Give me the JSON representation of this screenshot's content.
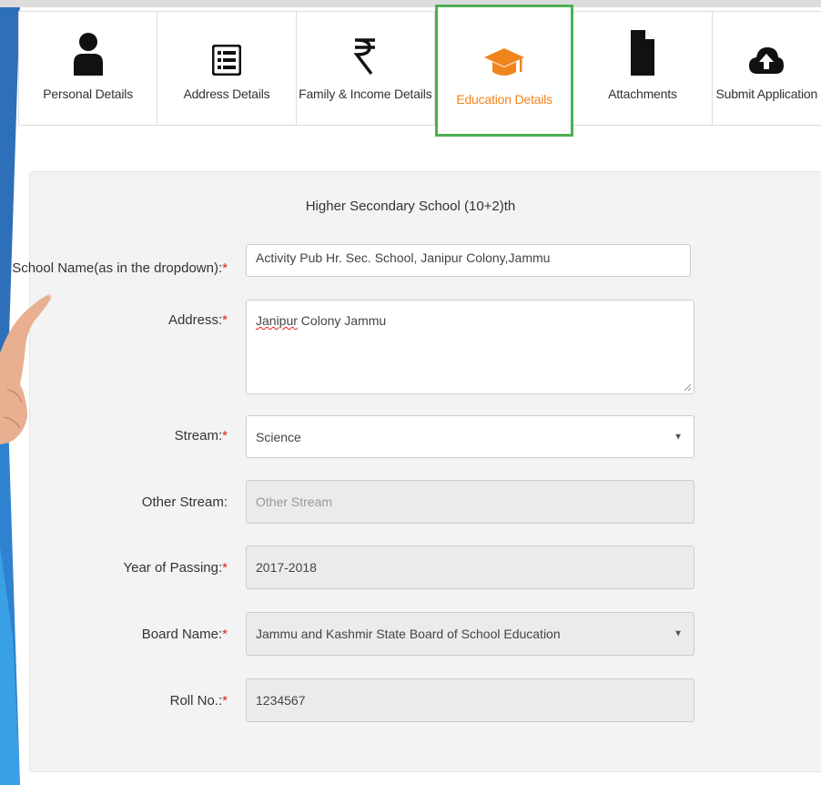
{
  "tabs": [
    {
      "label": "Personal Details",
      "icon": "person-icon"
    },
    {
      "label": "Address Details",
      "icon": "list-icon"
    },
    {
      "label": "Family & Income Details",
      "icon": "rupee-icon"
    },
    {
      "label": "Education Details",
      "icon": "graduation-cap-icon",
      "active": true
    },
    {
      "label": "Attachments",
      "icon": "document-icon"
    },
    {
      "label": "Submit Application",
      "icon": "cloud-upload-icon"
    }
  ],
  "colors": {
    "active_border": "#4caf50",
    "active_text": "#f0841e",
    "required": "#e02020"
  },
  "form": {
    "section_title": "Higher Secondary School (10+2)th",
    "school_name": {
      "label": "School Name(as in the dropdown):",
      "value": "Activity Pub Hr. Sec. School, Janipur Colony,Jammu"
    },
    "address": {
      "label": "Address:",
      "value_underlined": "Janipur",
      "value_rest": " Colony Jammu"
    },
    "stream": {
      "label": "Stream:",
      "value": "Science"
    },
    "other_stream": {
      "label": "Other Stream:",
      "placeholder": "Other Stream"
    },
    "year": {
      "label": "Year of Passing:",
      "value": "2017-2018"
    },
    "board": {
      "label": "Board Name:",
      "value": "Jammu and Kashmir State Board of School Education"
    },
    "roll": {
      "label": "Roll No.:",
      "value": "1234567"
    },
    "required_mark": "*"
  }
}
